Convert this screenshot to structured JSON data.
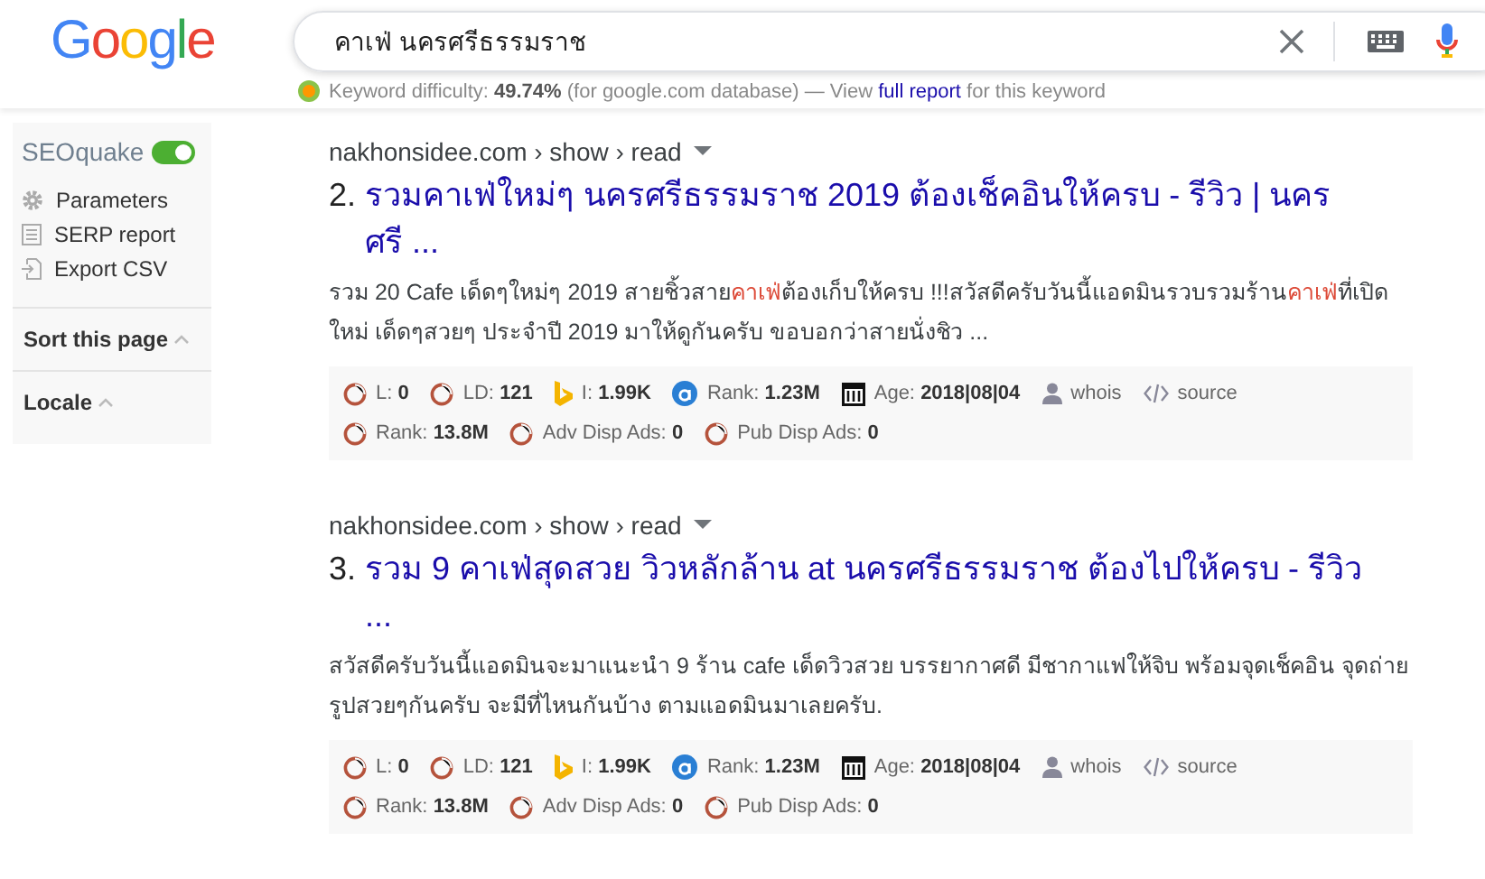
{
  "logo": [
    {
      "letter": "G",
      "color": "#4285f4"
    },
    {
      "letter": "o",
      "color": "#ea4335"
    },
    {
      "letter": "o",
      "color": "#fbbc05"
    },
    {
      "letter": "g",
      "color": "#4285f4"
    },
    {
      "letter": "l",
      "color": "#34a853"
    },
    {
      "letter": "e",
      "color": "#ea4335"
    }
  ],
  "search": {
    "value": "คาเฟ่ นครศรีธรรมราช"
  },
  "keyword_bar": {
    "label": "Keyword difficulty:",
    "value": "49.74%",
    "note": "(for google.com database) — View",
    "link": "full report",
    "tail": "for this keyword"
  },
  "sidebar": {
    "brand": "SEOquake",
    "on": true,
    "items": [
      {
        "kind": "gear",
        "label": "Parameters"
      },
      {
        "kind": "report",
        "label": "SERP report"
      },
      {
        "kind": "export",
        "label": "Export CSV"
      }
    ],
    "sections": [
      {
        "label": "Sort this page"
      },
      {
        "label": "Locale"
      }
    ]
  },
  "results": [
    {
      "breadcrumb": "nakhonsidee.com › show › read",
      "number": "2.",
      "title": "รวมคาเฟ่ใหม่ๆ นครศรีธรรมราช 2019 ต้องเช็คอินให้ครบ - รีวิว | นครศรี ...",
      "snippet": [
        {
          "text": "รวม 20 Cafe เด็ดๆใหม่ๆ 2019 สายชิ้วสาย",
          "highlight": false
        },
        {
          "text": "คาเฟ่",
          "highlight": true
        },
        {
          "text": "ต้องเก็บให้ครบ !!!สวัสดีครับวันนี้แอดมินรวบรวมร้าน",
          "highlight": false
        },
        {
          "text": "คาเฟ่",
          "highlight": true
        },
        {
          "text": "ที่เปิดใหม่ เด็ดๆสวยๆ ประจำปี 2019 มาให้ดูกันครับ ขอบอกว่าสายนั่งชิว ...",
          "highlight": false
        }
      ],
      "metrics": [
        [
          {
            "kind": "circle",
            "label": "L:",
            "value": "0"
          },
          {
            "kind": "circle",
            "label": "LD:",
            "value": "121"
          },
          {
            "kind": "bing",
            "label": "I:",
            "value": "1.99K"
          },
          {
            "kind": "alexa",
            "label": "Rank:",
            "value": "1.23M"
          },
          {
            "kind": "calendar",
            "label": "Age:",
            "value": "2018|08|04"
          },
          {
            "kind": "person",
            "label": "whois"
          },
          {
            "kind": "code",
            "label": "source"
          }
        ],
        [
          {
            "kind": "circle",
            "label": "Rank:",
            "value": "13.8M"
          },
          {
            "kind": "circle",
            "label": "Adv Disp Ads:",
            "value": "0"
          },
          {
            "kind": "circle",
            "label": "Pub Disp Ads:",
            "value": "0"
          }
        ]
      ]
    },
    {
      "breadcrumb": "nakhonsidee.com › show › read",
      "number": "3.",
      "title": "รวม 9 คาเฟ่สุดสวย วิวหลักล้าน at นครศรีธรรมราช ต้องไปให้ครบ - รีวิว ...",
      "snippet": [
        {
          "text": "สวัสดีครับวันนี้แอดมินจะมาแนะนำ 9 ร้าน cafe เด็ดวิวสวย บรรยากาศดี มีชากาแฟให้จิบ พร้อมจุดเช็คอิน จุดถ่ายรูปสวยๆกันครับ จะมีที่ไหนกันบ้าง ตามแอดมินมาเลยครับ.",
          "highlight": false
        }
      ],
      "metrics": [
        [
          {
            "kind": "circle",
            "label": "L:",
            "value": "0"
          },
          {
            "kind": "circle",
            "label": "LD:",
            "value": "121"
          },
          {
            "kind": "bing",
            "label": "I:",
            "value": "1.99K"
          },
          {
            "kind": "alexa",
            "label": "Rank:",
            "value": "1.23M"
          },
          {
            "kind": "calendar",
            "label": "Age:",
            "value": "2018|08|04"
          },
          {
            "kind": "person",
            "label": "whois"
          },
          {
            "kind": "code",
            "label": "source"
          }
        ],
        [
          {
            "kind": "circle",
            "label": "Rank:",
            "value": "13.8M"
          },
          {
            "kind": "circle",
            "label": "Adv Disp Ads:",
            "value": "0"
          },
          {
            "kind": "circle",
            "label": "Pub Disp Ads:",
            "value": "0"
          }
        ]
      ]
    }
  ]
}
